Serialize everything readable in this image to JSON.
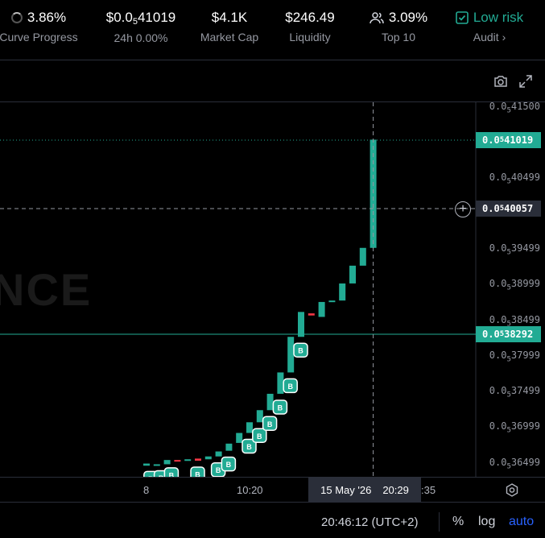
{
  "header": {
    "curve": {
      "value": "3.86%",
      "label": "Curve Progress"
    },
    "price": {
      "value_prefix": "$0.0",
      "value_sub": "5",
      "value_suffix": "41019",
      "label": "24h 0.00%"
    },
    "market_cap": {
      "value": "$4.1K",
      "label": "Market Cap"
    },
    "liquidity": {
      "value": "$246.49",
      "label": "Liquidity"
    },
    "top10": {
      "value": "3.09%",
      "label": "Top 10"
    },
    "audit": {
      "value": "Low risk",
      "label": "Audit ›"
    }
  },
  "watermark": "NCE",
  "price_axis": [
    {
      "p": "0.0",
      "s": "5",
      "r": "41500"
    },
    {
      "p": "0.0",
      "s": "5",
      "r": "40499"
    },
    {
      "p": "0.0",
      "s": "5",
      "r": "39499"
    },
    {
      "p": "0.0",
      "s": "5",
      "r": "38999"
    },
    {
      "p": "0.0",
      "s": "5",
      "r": "38499"
    },
    {
      "p": "0.0",
      "s": "5",
      "r": "37999"
    },
    {
      "p": "0.0",
      "s": "5",
      "r": "37499"
    },
    {
      "p": "0.0",
      "s": "5",
      "r": "36999"
    },
    {
      "p": "0.0",
      "s": "5",
      "r": "36499"
    }
  ],
  "tags": {
    "current": {
      "p": "0.0",
      "s": "5",
      "r": "41019"
    },
    "crosshair": {
      "p": "0.0",
      "s": "5",
      "r": "40057"
    },
    "level": {
      "p": "0.0",
      "s": "5",
      "r": "38292"
    }
  },
  "time_axis": {
    "t1": "8",
    "t2": "10:20",
    "t3": ":35"
  },
  "crosshair_time": {
    "date": "15 May '26",
    "time": "20:29"
  },
  "buy_marker_letter": "B",
  "footer": {
    "clock": "20:46:12 (UTC+2)",
    "percent": "%",
    "log": "log",
    "auto": "auto"
  },
  "colors": {
    "up": "#22ab94",
    "down": "#f23645",
    "bg": "#000000",
    "axis": "#2a2e39"
  },
  "chart_data": {
    "type": "candlestick",
    "ylim": [
      3.6499e-06,
      4.15e-06
    ],
    "candles": [
      {
        "o": 3.644e-06,
        "c": 3.647e-06,
        "up": true
      },
      {
        "o": 3.645e-06,
        "c": 3.646e-06,
        "up": true
      },
      {
        "o": 3.646e-06,
        "c": 3.652e-06,
        "up": true
      },
      {
        "o": 3.652e-06,
        "c": 3.65e-06,
        "up": false
      },
      {
        "o": 3.652e-06,
        "c": 3.653e-06,
        "up": true
      },
      {
        "o": 3.654e-06,
        "c": 3.651e-06,
        "up": false
      },
      {
        "o": 3.653e-06,
        "c": 3.657e-06,
        "up": true
      },
      {
        "o": 3.657e-06,
        "c": 3.664e-06,
        "up": true
      },
      {
        "o": 3.665e-06,
        "c": 3.675e-06,
        "up": true
      },
      {
        "o": 3.676e-06,
        "c": 3.69e-06,
        "up": true
      },
      {
        "o": 3.69e-06,
        "c": 3.705e-06,
        "up": true
      },
      {
        "o": 3.705e-06,
        "c": 3.722e-06,
        "up": true
      },
      {
        "o": 3.722e-06,
        "c": 3.745e-06,
        "up": true
      },
      {
        "o": 3.745e-06,
        "c": 3.775e-06,
        "up": true
      },
      {
        "o": 3.775e-06,
        "c": 3.825e-06,
        "up": true
      },
      {
        "o": 3.825e-06,
        "c": 3.86e-06,
        "up": true
      },
      {
        "o": 3.858e-06,
        "c": 3.855e-06,
        "up": false
      },
      {
        "o": 3.853e-06,
        "c": 3.874e-06,
        "up": true
      },
      {
        "o": 3.874e-06,
        "c": 3.876e-06,
        "up": true
      },
      {
        "o": 3.876e-06,
        "c": 3.9e-06,
        "up": true
      },
      {
        "o": 3.9e-06,
        "c": 3.925e-06,
        "up": true
      },
      {
        "o": 3.925e-06,
        "c": 3.95e-06,
        "up": true
      },
      {
        "o": 3.95e-06,
        "c": 4.102e-06,
        "up": true
      }
    ],
    "buy_markers": [
      1,
      2,
      3,
      5,
      7,
      8,
      10,
      11,
      12,
      13,
      14,
      15
    ]
  }
}
